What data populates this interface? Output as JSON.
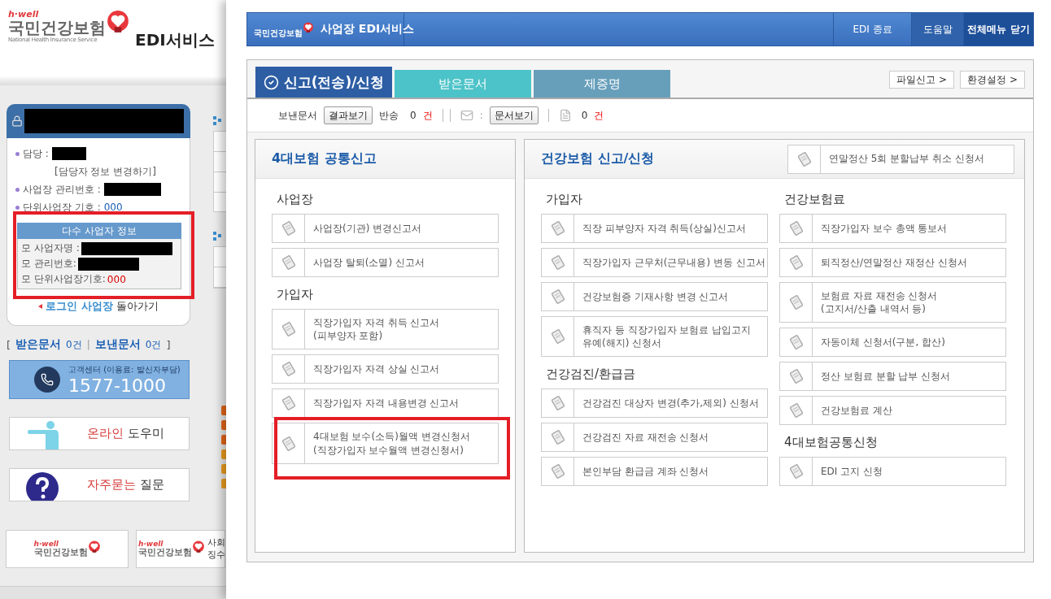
{
  "site_header": {
    "logo": {
      "tagline": "h·well",
      "name": "국민건강보험",
      "subtitle": "National Health Insurance Service"
    },
    "service_name": "EDI서비스"
  },
  "account_box": {
    "name_masked": true,
    "rows": [
      {
        "kind": "field",
        "label": "담당 :",
        "masked": true
      },
      {
        "kind": "link",
        "label": "[담당자 정보 변경하기]"
      },
      {
        "kind": "field",
        "label": "사업장 관리번호 :",
        "masked": true
      },
      {
        "kind": "field",
        "label": "단위사업장 기호 :",
        "masked": false,
        "value": "000"
      }
    ],
    "multi_business": {
      "title": "다수 사업자 정보",
      "annotated": true,
      "rows": [
        {
          "label": "모 사업자명 :",
          "masked": true
        },
        {
          "label": "모 관리번호:",
          "masked": true
        },
        {
          "label": "모 단위사업장기호:",
          "masked": false,
          "value": "000"
        }
      ]
    },
    "back_link": {
      "highlight": "로그인 사업장",
      "rest": "돌아가기"
    }
  },
  "doc_counts": {
    "open": "[",
    "close": "]",
    "separator": "|",
    "items": [
      {
        "label": "받은문서",
        "count": "0건"
      },
      {
        "label": "보낸문서",
        "count": "0건"
      }
    ]
  },
  "hotline": {
    "caption": "고객센터 (이용료: 발신자부담)",
    "number": "1577-1000"
  },
  "banners": [
    {
      "kind": "guide",
      "highlight": "온라인",
      "rest": "도우미"
    },
    {
      "kind": "faq",
      "highlight": "자주묻는",
      "rest": "질문"
    }
  ],
  "partner_logos": [
    {
      "tagline": "h·well",
      "name": "국민건강보험"
    },
    {
      "tagline": "h·well",
      "name": "국민건강보험",
      "caption_lines": [
        "사회",
        "징수"
      ]
    }
  ],
  "edi_window": {
    "logo_name": "국민건강보험",
    "title": "사업장 EDI서비스",
    "actions": [
      {
        "label": "EDI 종료",
        "kind": "plain"
      },
      {
        "label": "도움말",
        "kind": "dark"
      },
      {
        "label": "전체메뉴 닫기",
        "kind": "darker"
      }
    ],
    "tabs": [
      {
        "label": "신고(전송)/신청",
        "selected": true,
        "color": "#2d5ea4"
      },
      {
        "label": "받은문서",
        "selected": false,
        "color": "#4cc3c8"
      },
      {
        "label": "제증명",
        "selected": false,
        "color": "#679fbb"
      }
    ],
    "tool_links": [
      "파일신고 >",
      "환경설정 >"
    ],
    "toolbar": {
      "sent_label": "보낸문서",
      "result_button": "결과보기",
      "returned_label": "반송",
      "returned_count": "0",
      "returned_unit": "건",
      "colon": ":",
      "view_button": "문서보기",
      "doc_count": "0",
      "doc_unit": "건"
    },
    "common_section": {
      "title": "4대보험 공통신고",
      "groups": [
        {
          "title": "사업장",
          "items": [
            {
              "label": "사업장(기관) 변경신고서",
              "annotated": false
            },
            {
              "label": "사업장 탈퇴(소멸) 신고서",
              "annotated": false
            }
          ]
        },
        {
          "title": "가입자",
          "items": [
            {
              "label": "직장가입자 자격 취득 신고서\n(피부양자 포함)",
              "annotated": false
            },
            {
              "label": "직장가입자 자격 상실 신고서",
              "annotated": false
            },
            {
              "label": "직장가입자 자격 내용변경 신고서",
              "annotated": false
            },
            {
              "label": "4대보험 보수(소득)월액 변경신청서\n(직장가입자 보수월액 변경신청서)",
              "annotated": true
            }
          ]
        }
      ]
    },
    "health_section": {
      "title": "건강보험 신고/신청",
      "header_item": {
        "label": "연말정산 5회 분할납부 취소 신청서",
        "annotated": false
      },
      "columns": [
        [
          {
            "title": "가입자",
            "items": [
              {
                "label": "직장 피부양자 자격 취득(상실)신고서",
                "annotated": false
              },
              {
                "label": "직장가입자 근무처(근무내용) 변동 신고서",
                "annotated": false
              },
              {
                "label": "건강보험증 기재사항 변경 신고서",
                "annotated": false
              },
              {
                "label": "휴직자 등 직장가입자 보험료 납입고지\n유예(해지) 신청서",
                "annotated": false
              }
            ]
          },
          {
            "title": "건강검진/환급금",
            "items": [
              {
                "label": "건강검진 대상자 변경(추가,제외) 신청서",
                "annotated": false
              },
              {
                "label": "건강검진 자료 재전송 신청서",
                "annotated": false
              },
              {
                "label": "본인부담 환급금 계좌 신청서",
                "annotated": false
              }
            ]
          }
        ],
        [
          {
            "title": "건강보험료",
            "items": [
              {
                "label": "직장가입자 보수 총액 통보서",
                "annotated": false
              },
              {
                "label": "퇴직정산/연말정산 재정산 신청서",
                "annotated": false
              },
              {
                "label": "보험료 자료 재전송 신청서\n(고지서/산출 내역서 등)",
                "annotated": false
              },
              {
                "label": "자동이체 신청서(구분, 합산)",
                "annotated": false
              },
              {
                "label": "정산 보험료 분할 납부 신청서",
                "annotated": false
              },
              {
                "label": "건강보험료 계산",
                "annotated": false
              }
            ]
          },
          {
            "title": "4대보험공통신청",
            "items": [
              {
                "label": "EDI 고지 신청",
                "annotated": false
              }
            ]
          }
        ]
      ]
    }
  }
}
